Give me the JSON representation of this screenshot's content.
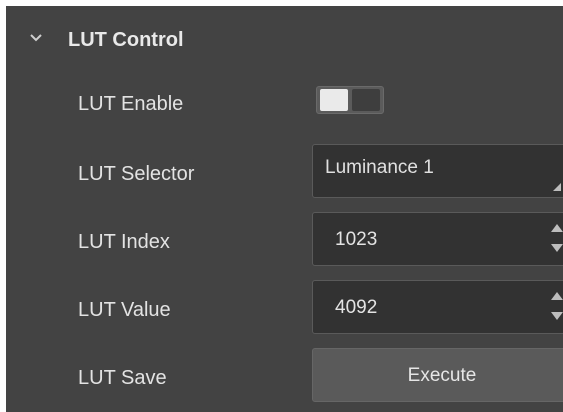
{
  "section": {
    "title": "LUT Control",
    "expanded_icon": "chevron-down-icon"
  },
  "rows": {
    "enable": {
      "label": "LUT Enable",
      "toggle_state": "off"
    },
    "selector": {
      "label": "LUT Selector",
      "value": "Luminance 1"
    },
    "index": {
      "label": "LUT Index",
      "value": "1023"
    },
    "value": {
      "label": "LUT Value",
      "value": "4092"
    },
    "save": {
      "label": "LUT Save",
      "button_label": "Execute"
    }
  },
  "colors": {
    "panel_bg": "#434343",
    "field_bg": "#323232",
    "button_bg": "#5a5a5a",
    "text": "#e3e3e3"
  }
}
